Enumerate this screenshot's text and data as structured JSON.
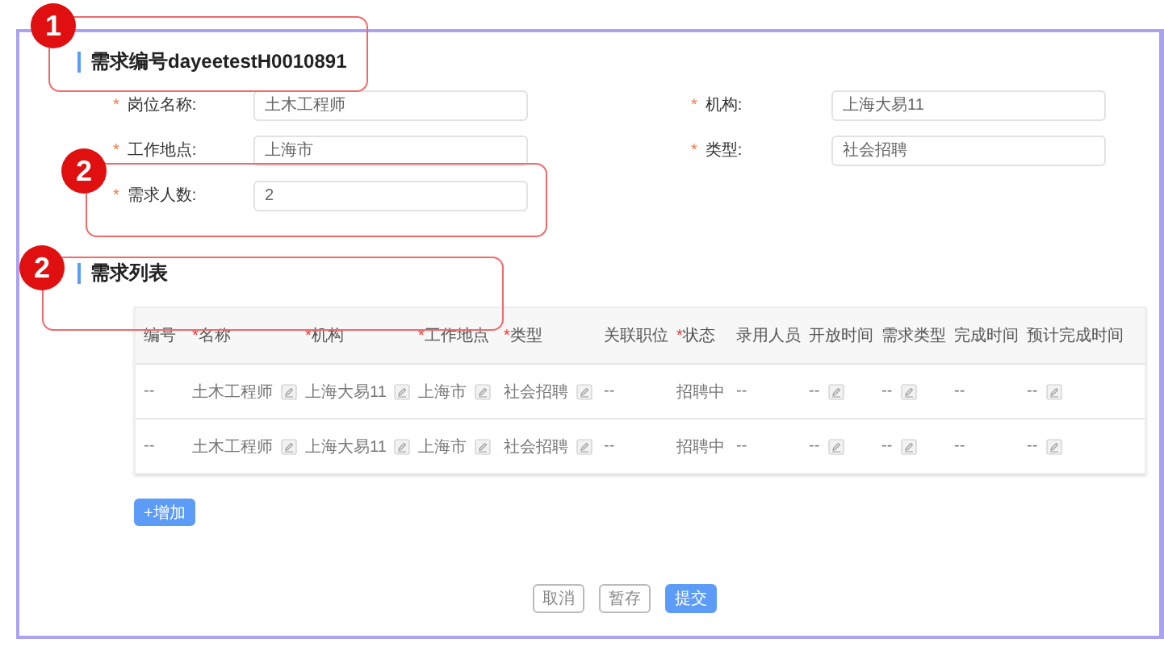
{
  "header": {
    "title": "需求编号dayeetestH0010891"
  },
  "form_fields": [
    {
      "label": "岗位名称:",
      "value": "土木工程师",
      "required_mark": "*"
    },
    {
      "label": "机构:",
      "value": "上海大易11",
      "required_mark": "*"
    },
    {
      "label": "工作地点:",
      "value": "上海市",
      "required_mark": "*"
    },
    {
      "label": "类型:",
      "value": "社会招聘",
      "required_mark": "*"
    },
    {
      "label": "需求人数:",
      "value": "2",
      "required_mark": "*"
    }
  ],
  "section": {
    "title": "需求列表"
  },
  "table": {
    "columns": [
      {
        "label": "编号"
      },
      {
        "label": "名称",
        "required_mark": "*"
      },
      {
        "label": "机构",
        "required_mark": "*"
      },
      {
        "label": "工作地点",
        "required_mark": "*"
      },
      {
        "label": "类型",
        "required_mark": "*"
      },
      {
        "label": "关联职位"
      },
      {
        "label": "状态",
        "required_mark": "*"
      },
      {
        "label": "录用人员"
      },
      {
        "label": "开放时间"
      },
      {
        "label": "需求类型"
      },
      {
        "label": "完成时间"
      },
      {
        "label": "预计完成时间"
      }
    ],
    "rows": [
      {
        "cells": [
          {
            "text": "--",
            "editable": false
          },
          {
            "text": "土木工程师",
            "editable": true
          },
          {
            "text": "上海大易11",
            "editable": true
          },
          {
            "text": "上海市",
            "editable": true
          },
          {
            "text": "社会招聘",
            "editable": true
          },
          {
            "text": "--",
            "editable": false
          },
          {
            "text": "招聘中",
            "editable": false
          },
          {
            "text": "--",
            "editable": false
          },
          {
            "text": "--",
            "editable": true
          },
          {
            "text": "--",
            "editable": true
          },
          {
            "text": "--",
            "editable": false
          },
          {
            "text": "--",
            "editable": true
          }
        ]
      },
      {
        "cells": [
          {
            "text": "--",
            "editable": false
          },
          {
            "text": "土木工程师",
            "editable": true
          },
          {
            "text": "上海大易11",
            "editable": true
          },
          {
            "text": "上海市",
            "editable": true
          },
          {
            "text": "社会招聘",
            "editable": true
          },
          {
            "text": "--",
            "editable": false
          },
          {
            "text": "招聘中",
            "editable": false
          },
          {
            "text": "--",
            "editable": false
          },
          {
            "text": "--",
            "editable": true
          },
          {
            "text": "--",
            "editable": true
          },
          {
            "text": "--",
            "editable": false
          },
          {
            "text": "--",
            "editable": true
          }
        ]
      }
    ]
  },
  "add_button": "+增加",
  "buttons": [
    {
      "label": "取消",
      "kind": "default"
    },
    {
      "label": "暂存",
      "kind": "default"
    },
    {
      "label": "提交",
      "kind": "primary"
    }
  ],
  "annotations": [
    {
      "number": "1"
    },
    {
      "number": "2"
    },
    {
      "number": "2"
    }
  ]
}
